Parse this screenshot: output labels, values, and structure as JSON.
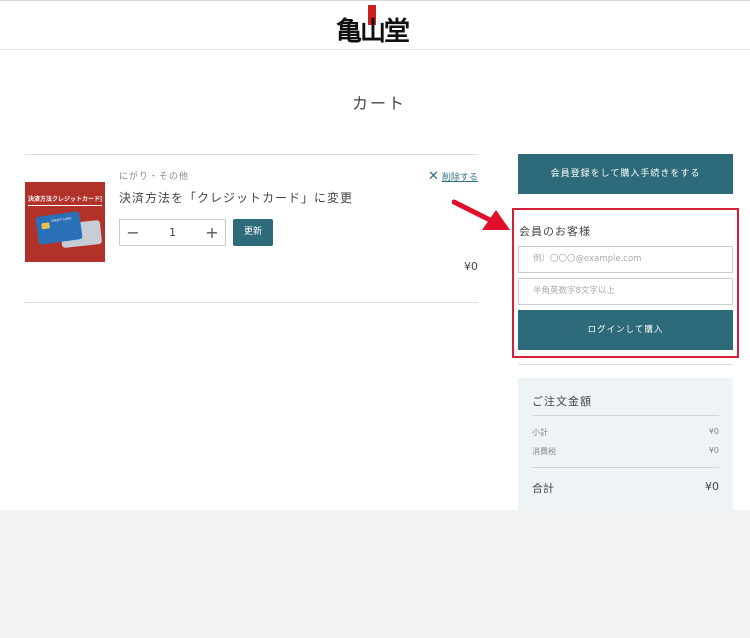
{
  "header": {
    "logo_text": "亀山堂"
  },
  "page": {
    "title": "カート"
  },
  "cart": {
    "item": {
      "category": "にがり・その他",
      "name": "決済方法を「クレジットカード」に変更",
      "image_caption": "決済方法クレジットカード変更",
      "image_card_label": "CREDIT CARD",
      "delete_label": "削除する",
      "quantity": "1",
      "update_label": "更新",
      "price": "¥0"
    }
  },
  "sidebar": {
    "register_button": "会員登録をして購入手続きをする",
    "member_title": "会員のお客様",
    "email_placeholder": "例）〇〇〇@example.com",
    "password_placeholder": "半角英数字8文字以上",
    "login_button": "ログインして購入"
  },
  "summary": {
    "title": "ご注文金額",
    "subtotal_label": "小計",
    "subtotal_value": "¥0",
    "tax_label": "消費税",
    "tax_value": "¥0",
    "total_label": "合計",
    "total_value": "¥0"
  },
  "colors": {
    "accent": "#2d6b7a",
    "highlight": "#d42135",
    "arrow": "#e0102a"
  },
  "icons": {
    "delete": "close-icon",
    "decrement": "minus-icon",
    "increment": "plus-icon",
    "annotation": "arrow-icon"
  }
}
